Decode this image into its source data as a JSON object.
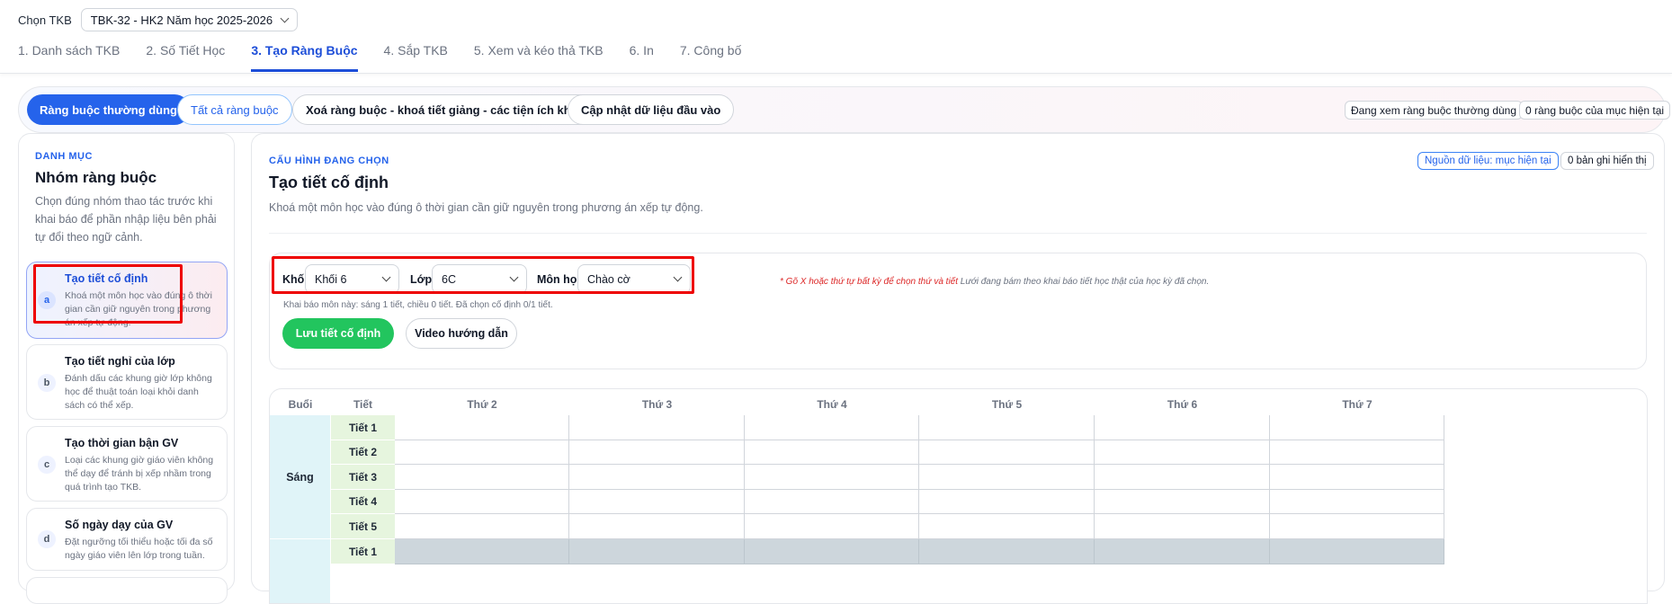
{
  "header": {
    "tkb_label": "Chọn TKB",
    "tkb_value": "TBK-32 - HK2 Năm học 2025-2026",
    "tabs": [
      {
        "label": "1. Danh sách TKB",
        "active": false
      },
      {
        "label": "2. Số Tiết Học",
        "active": false
      },
      {
        "label": "3. Tạo Ràng Buộc",
        "active": true
      },
      {
        "label": "4. Sắp TKB",
        "active": false
      },
      {
        "label": "5. Xem và kéo thả TKB",
        "active": false
      },
      {
        "label": "6. In",
        "active": false
      },
      {
        "label": "7. Công bố",
        "active": false
      }
    ]
  },
  "actions": {
    "common": "Ràng buộc thường dùng",
    "all": "Tất cả ràng buộc",
    "delete_lock": "Xoá ràng buộc - khoá tiết giảng - các tiện ích khác",
    "update": "Cập nhật dữ liệu đầu vào",
    "viewing_chip": "Đang xem ràng buộc thường dùng",
    "count_chip": "0 ràng buộc của mục hiện tại"
  },
  "sidebar": {
    "label": "DANH MỤC",
    "title": "Nhóm ràng buộc",
    "description": "Chọn đúng nhóm thao tác trước khi khai báo để phần nhập liệu bên phải tự đổi theo ngữ cảnh.",
    "items": [
      {
        "badge": "a",
        "title": "Tạo tiết cố định",
        "desc": "Khoá một môn học vào đúng ô thời gian cần giữ nguyên trong phương án xếp tự động.",
        "active": true
      },
      {
        "badge": "b",
        "title": "Tạo tiết nghỉ của lớp",
        "desc": "Đánh dấu các khung giờ lớp không học để thuật toán loại khỏi danh sách có thể xếp.",
        "active": false
      },
      {
        "badge": "c",
        "title": "Tạo thời gian bận GV",
        "desc": "Loại các khung giờ giáo viên không thể dạy để tránh bị xếp nhầm trong quá trình tạo TKB.",
        "active": false
      },
      {
        "badge": "d",
        "title": "Số ngày dạy của GV",
        "desc": "Đặt ngưỡng tối thiểu hoặc tối đa số ngày giáo viên lên lớp trong tuần.",
        "active": false
      }
    ]
  },
  "config": {
    "label": "CẤU HÌNH ĐANG CHỌN",
    "title": "Tạo tiết cố định",
    "description": "Khoá một môn học vào đúng ô thời gian cần giữ nguyên trong phương án xếp tự động.",
    "source_chip": "Nguồn dữ liệu: mục hiện tại",
    "records_chip": "0 bản ghi hiển thị"
  },
  "form": {
    "khoi_label": "Khối",
    "khoi_value": "Khối 6",
    "lop_label": "Lớp",
    "lop_value": "6C",
    "mon_label": "Môn học",
    "mon_value": "Chào cờ",
    "note_red": "* Gõ X hoặc thứ tự bất kỳ để chọn thứ và tiết",
    "note_gray": " Lưới đang bám theo khai báo tiết học thật của học kỳ đã chọn.",
    "subnote": "Khai báo môn này: sáng 1 tiết, chiều 0 tiết. Đã chọn cố định 0/1 tiết.",
    "save_button": "Lưu tiết cố định",
    "video_button": "Video hướng dẫn"
  },
  "grid": {
    "col_session": "Buổi",
    "col_period": "Tiết",
    "days": [
      "Thứ 2",
      "Thứ 3",
      "Thứ 4",
      "Thứ 5",
      "Thứ 6",
      "Thứ 7"
    ],
    "sessions": [
      {
        "name": "Sáng",
        "periods": [
          "Tiết 1",
          "Tiết 2",
          "Tiết 3",
          "Tiết 4",
          "Tiết 5"
        ]
      },
      {
        "name": "",
        "periods": [
          "Tiết 1"
        ]
      }
    ]
  }
}
